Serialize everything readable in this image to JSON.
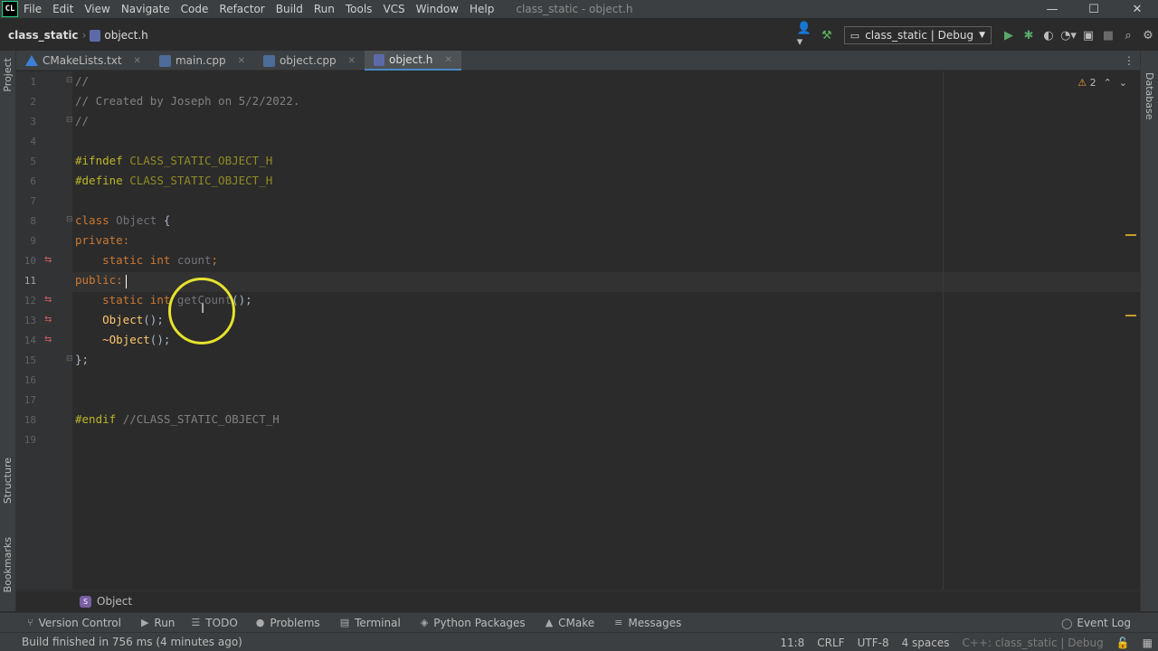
{
  "app": {
    "logo": "CL",
    "window_title": "class_static - object.h"
  },
  "menu": [
    "File",
    "Edit",
    "View",
    "Navigate",
    "Code",
    "Refactor",
    "Build",
    "Run",
    "Tools",
    "VCS",
    "Window",
    "Help"
  ],
  "window_controls": {
    "minimize": "—",
    "maximize": "☐",
    "close": "✕"
  },
  "breadcrumb": {
    "project": "class_static",
    "file": "object.h"
  },
  "run_config": {
    "label": "class_static | Debug"
  },
  "tabs": [
    {
      "label": "CMakeLists.txt",
      "icon": "cmake-icon",
      "active": false
    },
    {
      "label": "main.cpp",
      "icon": "cpp-file-icon",
      "active": false
    },
    {
      "label": "object.cpp",
      "icon": "cpp-file-icon",
      "active": false
    },
    {
      "label": "object.h",
      "icon": "header-file-icon",
      "active": true
    }
  ],
  "side_tabs": {
    "project": "Project",
    "structure": "Structure",
    "bookmarks": "Bookmarks",
    "database": "Database"
  },
  "inspection": {
    "warnings": "2"
  },
  "editor": {
    "line_numbers": [
      "1",
      "2",
      "3",
      "4",
      "5",
      "6",
      "7",
      "8",
      "9",
      "10",
      "11",
      "12",
      "13",
      "14",
      "15",
      "16",
      "17",
      "18",
      "19"
    ],
    "current_line": "11",
    "tokens": {
      "l1": "//",
      "l2": "// Created by Joseph on 5/2/2022.",
      "l3": "//",
      "l5_kw": "#ifndef",
      "l5_macro": "CLASS_STATIC_OBJECT_H",
      "l6_kw": "#define",
      "l6_macro": "CLASS_STATIC_OBJECT_H",
      "l8_kw": "class",
      "l8_cls": "Object",
      "l8_brace": "{",
      "l9": "private:",
      "l10_kw": "static int",
      "l10_var": "count",
      "l10_semi": ";",
      "l11": "public:",
      "l12_kw": "static int",
      "l12_fn": "getCount",
      "l12_rest": "();",
      "l13_fn": "Object",
      "l13_rest": "();",
      "l14_fn": "~Object",
      "l14_rest": "();",
      "l15": "};",
      "l18_kw": "#endif",
      "l18_comment": "//CLASS_STATIC_OBJECT_H"
    }
  },
  "structure_crumb": {
    "label": "Object"
  },
  "tool_windows": [
    {
      "label": "Version Control",
      "icon": "branch-icon"
    },
    {
      "label": "Run",
      "icon": "run-icon"
    },
    {
      "label": "TODO",
      "icon": "list-icon"
    },
    {
      "label": "Problems",
      "icon": "info-icon"
    },
    {
      "label": "Terminal",
      "icon": "terminal-icon"
    },
    {
      "label": "Python Packages",
      "icon": "layers-icon"
    },
    {
      "label": "CMake",
      "icon": "triangle-icon"
    },
    {
      "label": "Messages",
      "icon": "lines-icon"
    }
  ],
  "event_log": "Event Log",
  "status": {
    "message": "Build finished in 756 ms (4 minutes ago)",
    "position": "11:8",
    "line_sep": "CRLF",
    "encoding": "UTF-8",
    "indent": "4 spaces",
    "context": "C++: class_static | Debug"
  }
}
